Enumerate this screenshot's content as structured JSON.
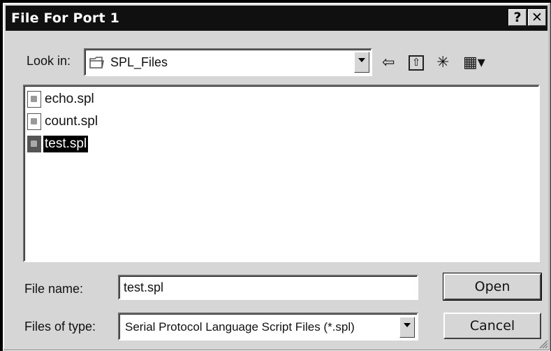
{
  "window": {
    "title": "File For Port 1",
    "help_glyph": "?",
    "close_glyph": "✕"
  },
  "look_in": {
    "label": "Look in:",
    "value": "SPL_Files"
  },
  "toolbar": {
    "back_glyph": "⇦",
    "up_glyph": "⇧",
    "new_folder_glyph": "✳",
    "view_glyph": "▦▾"
  },
  "files": [
    {
      "name": "echo.spl",
      "selected": false
    },
    {
      "name": "count.spl",
      "selected": false
    },
    {
      "name": "test.spl",
      "selected": true
    }
  ],
  "file_name": {
    "label": "File name:",
    "value": "test.spl"
  },
  "files_of_type": {
    "label": "Files of type:",
    "value": "Serial Protocol Language Script Files (*.spl)"
  },
  "buttons": {
    "open": "Open",
    "cancel": "Cancel"
  }
}
